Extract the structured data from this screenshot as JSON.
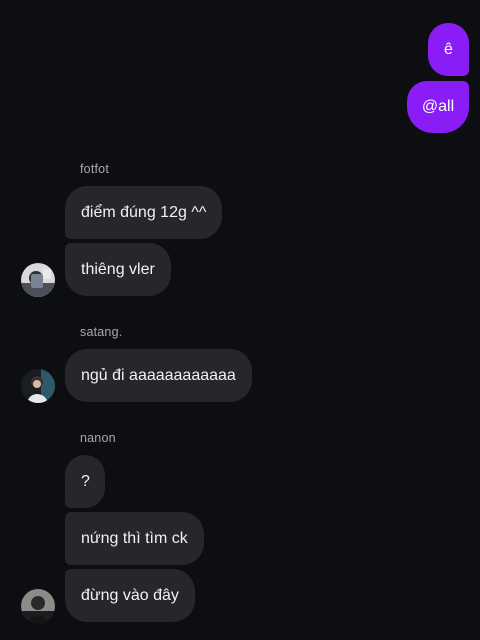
{
  "outgoing": [
    {
      "text": "ê"
    },
    {
      "text": "@all"
    }
  ],
  "groups": [
    {
      "sender": "fotfot",
      "messages": [
        "điểm đúng 12g ^^",
        "thiêng vler"
      ]
    },
    {
      "sender": "satang.",
      "messages": [
        "ngủ đi aaaaaaaaaaaa"
      ]
    },
    {
      "sender": "nanon",
      "messages": [
        "?",
        "nứng thì tìm ck",
        "đừng vào đây"
      ]
    }
  ],
  "colors": {
    "background": "#0d0e12",
    "outgoing_bubble": "#8a1cf5",
    "incoming_bubble": "#26272c",
    "sender_name": "#a8a8ae"
  }
}
